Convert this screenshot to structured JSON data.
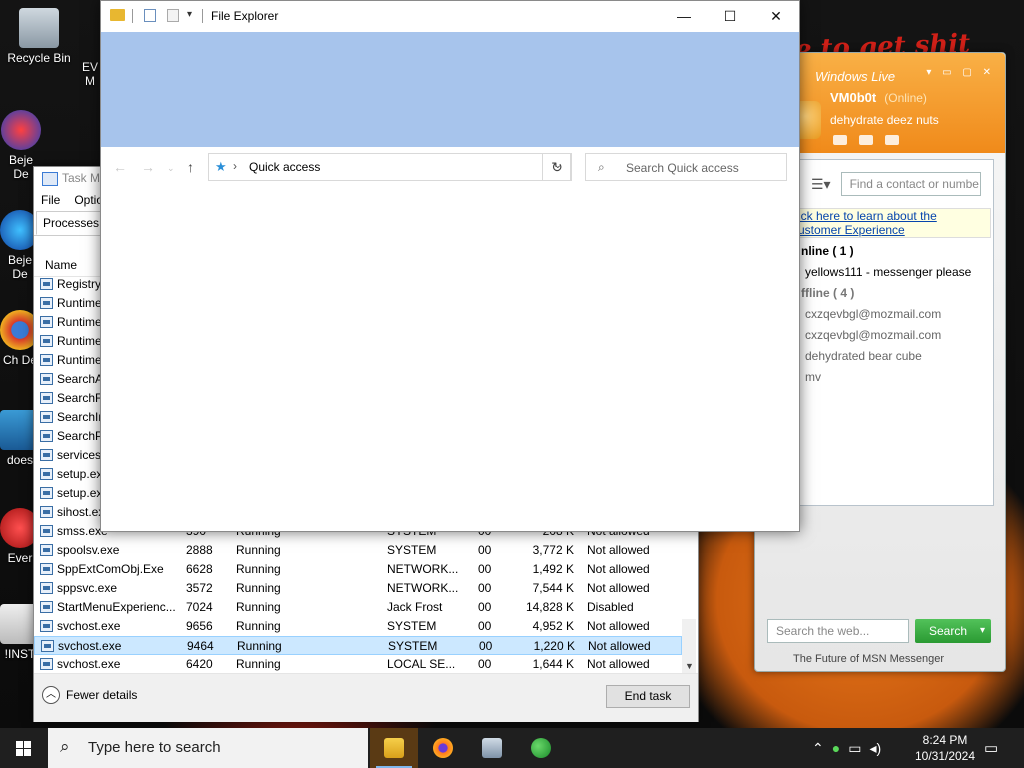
{
  "desktop": {
    "wallpaper_text": "e to get shit",
    "icons": [
      {
        "label": "Recycle Bin"
      },
      {
        "label": "EV M"
      },
      {
        "label": "Beje De"
      },
      {
        "label": "Beje De"
      },
      {
        "label": "Ch De"
      },
      {
        "label": "does"
      },
      {
        "label": "Ever"
      },
      {
        "label": "!INST"
      }
    ]
  },
  "explorer": {
    "title": "File Explorer",
    "address": "Quick access",
    "search_placeholder": "Search Quick access",
    "colors": {
      "ribbon": "#a7c4ec"
    }
  },
  "taskmgr": {
    "title": "Task Ma",
    "menu": [
      "File",
      "Optio"
    ],
    "tab": "Processes",
    "column_name": "Name",
    "rows_top": [
      {
        "name": "Registry"
      },
      {
        "name": "Runtime"
      },
      {
        "name": "Runtime"
      },
      {
        "name": "Runtime"
      },
      {
        "name": "Runtime"
      },
      {
        "name": "SearchA"
      },
      {
        "name": "SearchFi"
      },
      {
        "name": "SearchIn"
      },
      {
        "name": "SearchPr"
      },
      {
        "name": "services."
      },
      {
        "name": "setup.ex"
      },
      {
        "name": "setup.ex"
      },
      {
        "name": "sihost.ex"
      }
    ],
    "rows": [
      {
        "name": "smss.exe",
        "pid": "390",
        "status": "Running",
        "user": "SYSTEM",
        "cpu": "00",
        "mem": "208 K",
        "uac": "Not allowed"
      },
      {
        "name": "spoolsv.exe",
        "pid": "2888",
        "status": "Running",
        "user": "SYSTEM",
        "cpu": "00",
        "mem": "3,772 K",
        "uac": "Not allowed"
      },
      {
        "name": "SppExtComObj.Exe",
        "pid": "6628",
        "status": "Running",
        "user": "NETWORK...",
        "cpu": "00",
        "mem": "1,492 K",
        "uac": "Not allowed"
      },
      {
        "name": "sppsvc.exe",
        "pid": "3572",
        "status": "Running",
        "user": "NETWORK...",
        "cpu": "00",
        "mem": "7,544 K",
        "uac": "Not allowed"
      },
      {
        "name": "StartMenuExperienc...",
        "pid": "7024",
        "status": "Running",
        "user": "Jack Frost",
        "cpu": "00",
        "mem": "14,828 K",
        "uac": "Disabled"
      },
      {
        "name": "svchost.exe",
        "pid": "9656",
        "status": "Running",
        "user": "SYSTEM",
        "cpu": "00",
        "mem": "4,952 K",
        "uac": "Not allowed"
      },
      {
        "name": "svchost.exe",
        "pid": "9464",
        "status": "Running",
        "user": "SYSTEM",
        "cpu": "00",
        "mem": "1,220 K",
        "uac": "Not allowed"
      },
      {
        "name": "svchost.exe",
        "pid": "6420",
        "status": "Running",
        "user": "LOCAL SE...",
        "cpu": "00",
        "mem": "1,644 K",
        "uac": "Not allowed"
      }
    ],
    "fewer_details": "Fewer details",
    "end_task": "End task",
    "selected_row_index": 6
  },
  "msn": {
    "brand": "Windows Live",
    "username": "VM0b0t",
    "status": "(Online)",
    "personal_message": "dehydrate deez nuts",
    "find_placeholder": "Find a contact or numbe",
    "info_line1": "ick here to learn about the",
    "info_line2": "ustomer Experience",
    "group_online": "nline ( 1 )",
    "online_contacts": [
      "yellows111 - messenger please"
    ],
    "group_offline": "ffline ( 4 )",
    "offline_contacts": [
      "cxzqevbgl@mozmail.com",
      "cxzqevbgl@mozmail.com",
      "dehydrated bear cube",
      "mv"
    ],
    "web_search_placeholder": "Search the web...",
    "search_button": "Search",
    "footer": "The Future of MSN Messenger",
    "colors": {
      "header": "#f08a1a",
      "search": "#2a9a32"
    }
  },
  "taskbar": {
    "search_placeholder": "Type here to search",
    "time": "8:24 PM",
    "date": "10/31/2024"
  }
}
